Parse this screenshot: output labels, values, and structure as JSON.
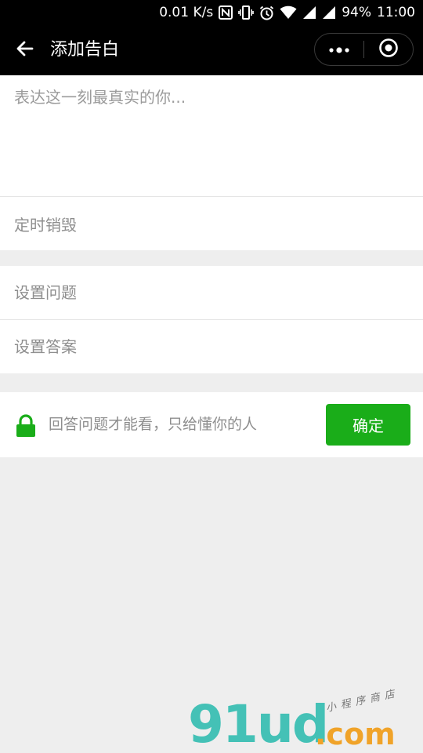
{
  "status_bar": {
    "speed": "0.01 K/s",
    "battery": "94%",
    "time": "11:00"
  },
  "nav": {
    "title": "添加告白"
  },
  "form": {
    "content_placeholder": "表达这一刻最真实的你...",
    "timer_label": "定时销毁",
    "question_placeholder": "设置问题",
    "answer_placeholder": "设置答案"
  },
  "hint": {
    "text": "回答问题才能看，只给懂你的人",
    "confirm_label": "确定"
  },
  "watermark": {
    "main": "91ud",
    "domain": ".com",
    "sub": "小程序商店"
  },
  "colors": {
    "accent": "#1aad19",
    "nav_bg": "#000000",
    "page_bg": "#eeeeee"
  },
  "icons": {
    "back": "arrow-left-icon",
    "more": "more-dots-icon",
    "close": "circle-target-icon",
    "lock": "lock-icon"
  }
}
